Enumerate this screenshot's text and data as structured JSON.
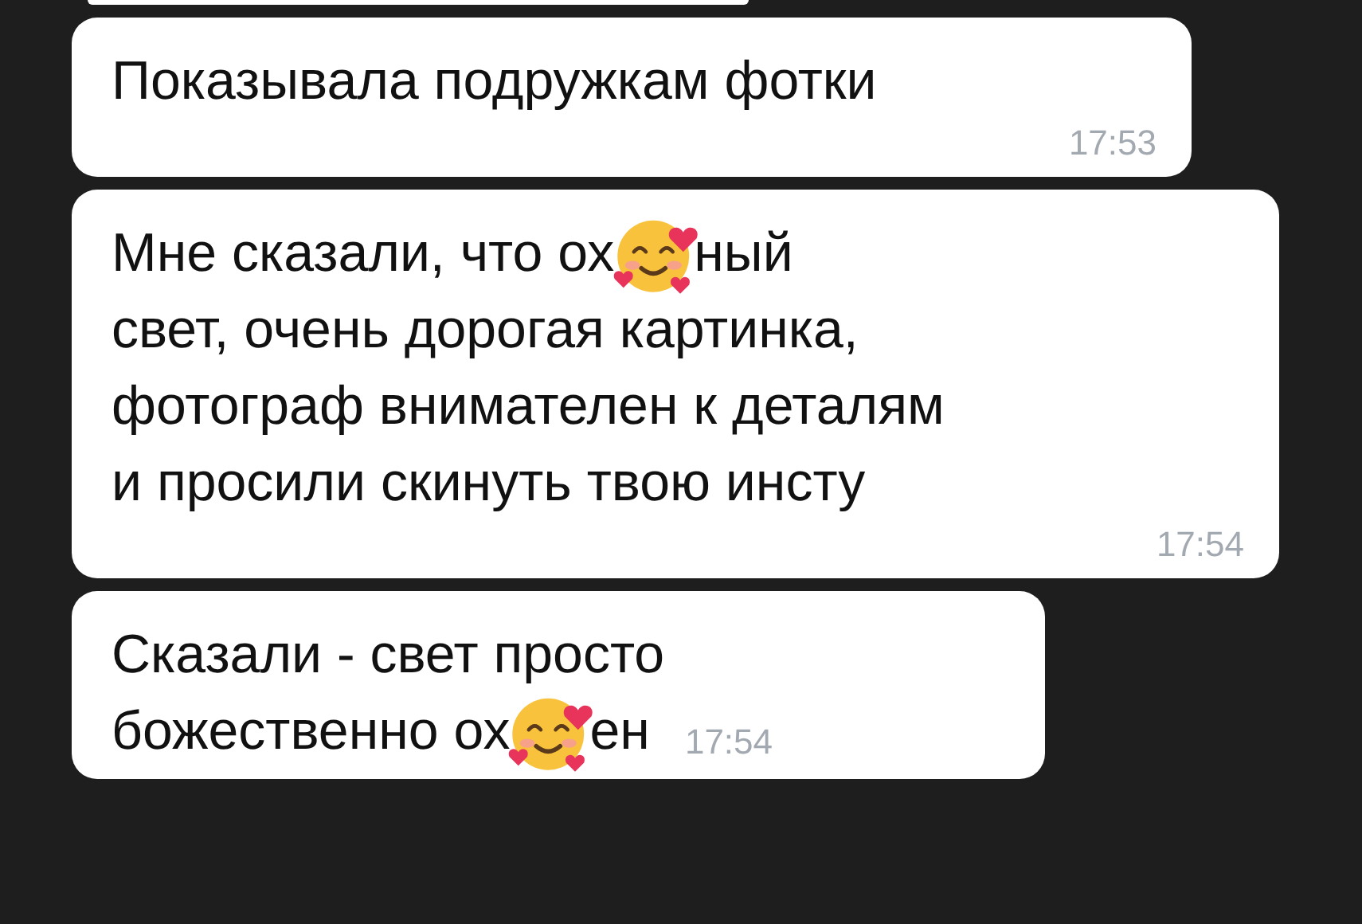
{
  "messages": [
    {
      "lines": [
        [
          {
            "kind": "text",
            "text": "Показывала подружкам фотки"
          }
        ]
      ],
      "time": "17:53"
    },
    {
      "lines": [
        [
          {
            "kind": "text",
            "text": "Мне сказали, что ох"
          },
          {
            "kind": "emoji"
          },
          {
            "kind": "text",
            "text": "ный"
          }
        ],
        [
          {
            "kind": "text",
            "text": "свет, очень дорогая картинка,"
          }
        ],
        [
          {
            "kind": "text",
            "text": "фотограф внимателен к деталям"
          }
        ],
        [
          {
            "kind": "text",
            "text": "и просили скинуть твою инсту"
          }
        ]
      ],
      "time": "17:54"
    },
    {
      "lines": [
        [
          {
            "kind": "text",
            "text": "Сказали - свет просто"
          }
        ],
        [
          {
            "kind": "text",
            "text": "божественно ох"
          },
          {
            "kind": "emoji"
          },
          {
            "kind": "text",
            "text": "ен"
          }
        ]
      ],
      "time": "17:54"
    }
  ]
}
